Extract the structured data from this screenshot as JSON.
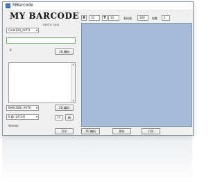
{
  "window": {
    "title": "MBarcode"
  },
  "header": {
    "title": "MY BARCODE",
    "subtitle": "MOTO YAN"
  },
  "left_panel": {
    "symbology_select": "Code128_AUTO",
    "data_input": "",
    "check_label": "0",
    "encode_button": "1D 编码",
    "text_area": "",
    "qr_select": "BARCODE_AUTO",
    "encode_2d_button": "2D 编码",
    "size_select": "8 级 (24*24)",
    "size_value": "10",
    "size_button": "级",
    "version_label": "Version",
    "print_button": "打印"
  },
  "toolbar": {
    "x_label": "X",
    "x_value": "10",
    "y_label": "Y",
    "y_value": "10",
    "width_label": "条码高",
    "width_value": "300",
    "ratio_label": "倍数",
    "ratio_value": "2"
  },
  "bottom_buttons": {
    "encode_label": "2D 编码",
    "save_label": "保存",
    "print_label": "打印"
  }
}
